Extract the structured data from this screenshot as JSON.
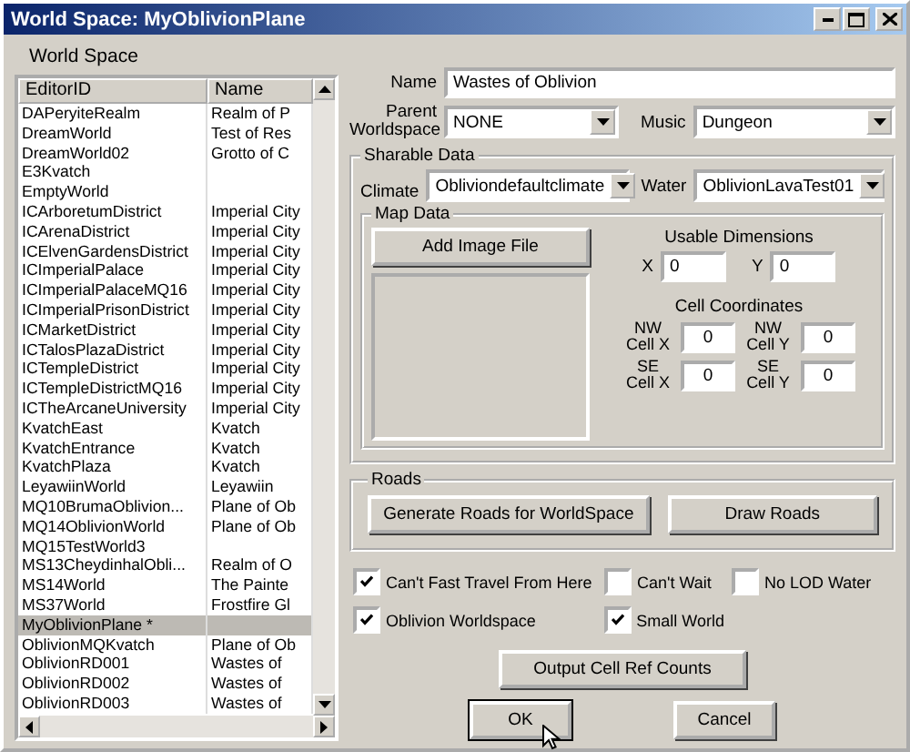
{
  "window": {
    "title": "World Space: MyOblivionPlane"
  },
  "list": {
    "label": "World Space",
    "columns": [
      "EditorID",
      "Name"
    ],
    "rows": [
      {
        "editor_id": "DAPeryiteRealm",
        "name": "Realm of P",
        "selected": false
      },
      {
        "editor_id": "DreamWorld",
        "name": "Test of Res",
        "selected": false
      },
      {
        "editor_id": "DreamWorld02",
        "name": "Grotto of C",
        "selected": false
      },
      {
        "editor_id": "E3Kvatch",
        "selected": false
      },
      {
        "editor_id": "EmptyWorld",
        "selected": false
      },
      {
        "editor_id": "ICArboretumDistrict",
        "name": "Imperial City",
        "selected": false
      },
      {
        "editor_id": "ICArenaDistrict",
        "name": "Imperial City",
        "selected": false
      },
      {
        "editor_id": "ICElvenGardensDistrict",
        "name": "Imperial City",
        "selected": false
      },
      {
        "editor_id": "ICImperialPalace",
        "name": "Imperial City",
        "selected": false
      },
      {
        "editor_id": "ICImperialPalaceMQ16",
        "name": "Imperial City",
        "selected": false
      },
      {
        "editor_id": "ICImperialPrisonDistrict",
        "name": "Imperial City",
        "selected": false
      },
      {
        "editor_id": "ICMarketDistrict",
        "name": "Imperial City",
        "selected": false
      },
      {
        "editor_id": "ICTalosPlazaDistrict",
        "name": "Imperial City",
        "selected": false
      },
      {
        "editor_id": "ICTempleDistrict",
        "name": "Imperial City",
        "selected": false
      },
      {
        "editor_id": "ICTempleDistrictMQ16",
        "name": "Imperial City",
        "selected": false
      },
      {
        "editor_id": "ICTheArcaneUniversity",
        "name": "Imperial City",
        "selected": false
      },
      {
        "editor_id": "KvatchEast",
        "name": "Kvatch",
        "selected": false
      },
      {
        "editor_id": "KvatchEntrance",
        "name": "Kvatch",
        "selected": false
      },
      {
        "editor_id": "KvatchPlaza",
        "name": "Kvatch",
        "selected": false
      },
      {
        "editor_id": "LeyawiinWorld",
        "name": "Leyawiin",
        "selected": false
      },
      {
        "editor_id": "MQ10BrumaOblivion...",
        "name": "Plane of Ob",
        "selected": false
      },
      {
        "editor_id": "MQ14OblivionWorld",
        "name": "Plane of Ob",
        "selected": false
      },
      {
        "editor_id": "MQ15TestWorld3",
        "selected": false
      },
      {
        "editor_id": "MS13CheydinhalObli...",
        "name": "Realm of O",
        "selected": false
      },
      {
        "editor_id": "MS14World",
        "name": "The Painte",
        "selected": false
      },
      {
        "editor_id": "MS37World",
        "name": "Frostfire Gl",
        "selected": false
      },
      {
        "editor_id": "MyOblivionPlane *",
        "selected": true
      },
      {
        "editor_id": "OblivionMQKvatch",
        "name": "Plane of Ob",
        "selected": false
      },
      {
        "editor_id": "OblivionRD001",
        "name": "Wastes of",
        "selected": false
      },
      {
        "editor_id": "OblivionRD002",
        "name": "Wastes of",
        "selected": false
      },
      {
        "editor_id": "OblivionRD003",
        "name": "Wastes of",
        "selected": false
      }
    ]
  },
  "form": {
    "name_label": "Name",
    "name_value": "Wastes of Oblivion",
    "parent_label": "Parent Worldspace",
    "parent_value": "NONE",
    "music_label": "Music",
    "music_value": "Dungeon"
  },
  "sharable_data": {
    "title": "Sharable Data",
    "climate_label": "Climate",
    "climate_value": "Obliviondefaultclimate",
    "water_label": "Water",
    "water_value": "OblivionLavaTest01",
    "map_data": {
      "title": "Map Data",
      "add_image_button": "Add Image File",
      "usable_dimensions": {
        "title": "Usable Dimensions",
        "fields": [
          {
            "label": "X",
            "value": "0"
          },
          {
            "label": "Y",
            "value": "0"
          }
        ]
      },
      "cell_coordinates": {
        "title": "Cell Coordinates",
        "fields": [
          {
            "label": "NW Cell X",
            "value": "0"
          },
          {
            "label": "NW Cell Y",
            "value": "0"
          },
          {
            "label": "SE Cell X",
            "value": "0"
          },
          {
            "label": "SE Cell Y",
            "value": "0"
          }
        ]
      }
    }
  },
  "roads": {
    "title": "Roads",
    "buttons": [
      "Generate Roads for WorldSpace",
      "Draw Roads"
    ]
  },
  "options": [
    {
      "label": "Can't Fast Travel From Here",
      "checked": true
    },
    {
      "label": "Can't Wait",
      "checked": false
    },
    {
      "label": "No LOD Water",
      "checked": false
    },
    {
      "label": "Oblivion Worldspace",
      "checked": true
    },
    {
      "label": "Small World",
      "checked": true
    }
  ],
  "output_button": "Output Cell Ref Counts",
  "dialog_buttons": [
    "OK",
    "Cancel"
  ]
}
